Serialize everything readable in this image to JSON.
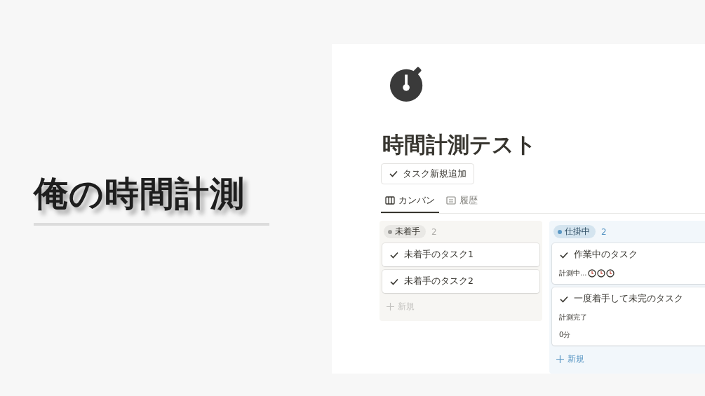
{
  "hero": {
    "title": "俺の時間計測"
  },
  "page": {
    "title": "時間計測テスト",
    "add_button": "タスク新規追加"
  },
  "tabs": [
    {
      "label": "カンバン",
      "kind": "board",
      "selected": true
    },
    {
      "label": "履歴",
      "kind": "list",
      "selected": false
    }
  ],
  "columns": [
    {
      "label": "未着手",
      "count": "2",
      "color": "#9b9a97",
      "kind": "gray",
      "cards": [
        {
          "title": "未着手のタスク1"
        },
        {
          "title": "未着手のタスク2"
        }
      ],
      "new_label": "新規"
    },
    {
      "label": "仕掛中",
      "count": "2",
      "color": "#5a97c4",
      "kind": "blue",
      "cards": [
        {
          "title": "作業中のタスク",
          "lines": [
            {
              "text": "計測中...",
              "timer_icons": true
            }
          ]
        },
        {
          "title": "一度着手して未完のタスク",
          "lines": [
            {
              "text": "計測完了",
              "timer_icons": false
            },
            {
              "text": "0分",
              "timer_icons": false
            }
          ]
        }
      ],
      "new_label": "新規"
    }
  ]
}
